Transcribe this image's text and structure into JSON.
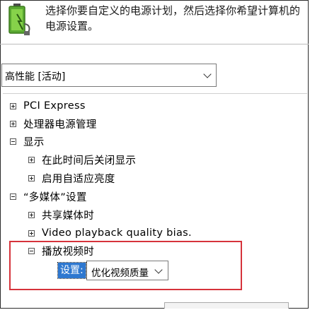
{
  "header": {
    "description": "选择你要自定义的电源计划，然后选择你希望计算机的电源设置。"
  },
  "plan": {
    "selected": "高性能 [活动]"
  },
  "tree": {
    "pci_express": "PCI Express",
    "processor": "处理器电源管理",
    "display": "显示",
    "display_off": "在此时间后关闭显示",
    "adaptive_brightness": "启用自适应亮度",
    "multimedia": "“多媒体”设置",
    "sharing_media": "共享媒体时",
    "video_quality_bias": "Video playback quality bias.",
    "playing_video": "播放视频时"
  },
  "setting": {
    "label": "设置:",
    "value": "优化视频质量"
  }
}
